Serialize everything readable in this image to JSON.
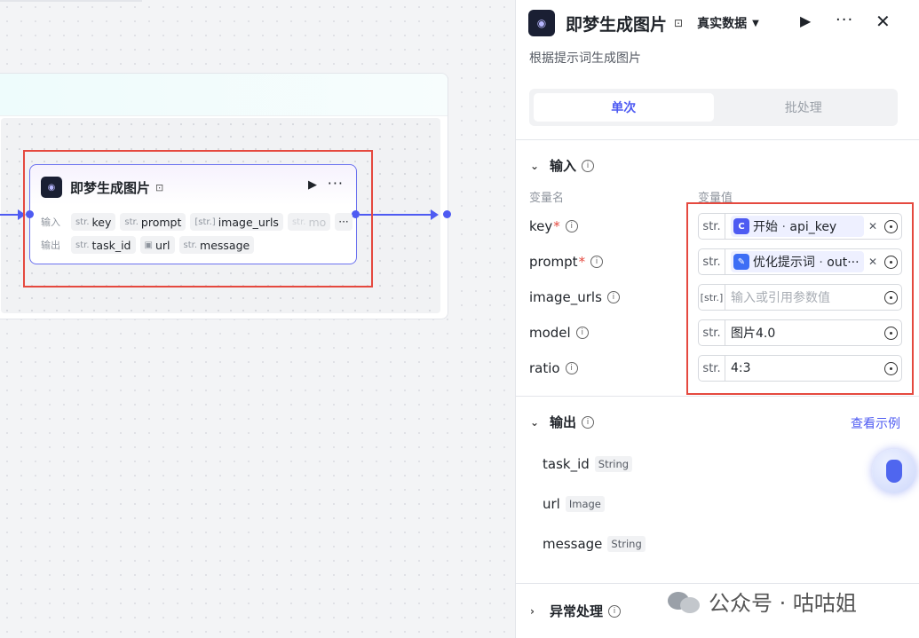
{
  "node": {
    "title": "即梦生成图片",
    "input_label": "输入",
    "output_label": "输出",
    "inputs": [
      {
        "type": "str.",
        "name": "key"
      },
      {
        "type": "str.",
        "name": "prompt"
      },
      {
        "type": "[str.]",
        "name": "image_urls"
      },
      {
        "type": "str.",
        "name": "mo"
      }
    ],
    "outputs": [
      {
        "type": "str.",
        "name": "task_id"
      },
      {
        "type": "image-icon",
        "name": "url"
      },
      {
        "type": "str.",
        "name": "message"
      }
    ],
    "more_inputs": "···"
  },
  "panel": {
    "title": "即梦生成图片",
    "mode": "真实数据",
    "description": "根据提示词生成图片",
    "tabs": [
      {
        "label": "单次",
        "active": true
      },
      {
        "label": "批处理",
        "active": false
      }
    ],
    "input_section": {
      "title": "输入",
      "col_name": "变量名",
      "col_value": "变量值",
      "params": [
        {
          "name": "key",
          "required": true,
          "type": "str.",
          "ref": {
            "source": "开始",
            "var": "api_key",
            "icon": "start-icon",
            "color": "#4e5bf2",
            "glyph": "C"
          }
        },
        {
          "name": "prompt",
          "required": true,
          "type": "str.",
          "ref": {
            "source": "优化提示词",
            "var": "out···",
            "icon": "llm-icon",
            "color": "#3d6ef5",
            "glyph": "✎"
          }
        },
        {
          "name": "image_urls",
          "required": false,
          "type": "[str.]",
          "placeholder": "输入或引用参数值"
        },
        {
          "name": "model",
          "required": false,
          "type": "str.",
          "value": "图片4.0"
        },
        {
          "name": "ratio",
          "required": false,
          "type": "str.",
          "value": "4:3"
        }
      ]
    },
    "output_section": {
      "title": "输出",
      "example_link": "查看示例",
      "items": [
        {
          "name": "task_id",
          "type": "String"
        },
        {
          "name": "url",
          "type": "Image"
        },
        {
          "name": "message",
          "type": "String"
        }
      ]
    },
    "exception_section": {
      "title": "异常处理"
    }
  },
  "watermark": {
    "text": "公众号 · 咕咕姐"
  },
  "colors": {
    "accent": "#4e5bf2",
    "highlight": "#e5493f"
  }
}
